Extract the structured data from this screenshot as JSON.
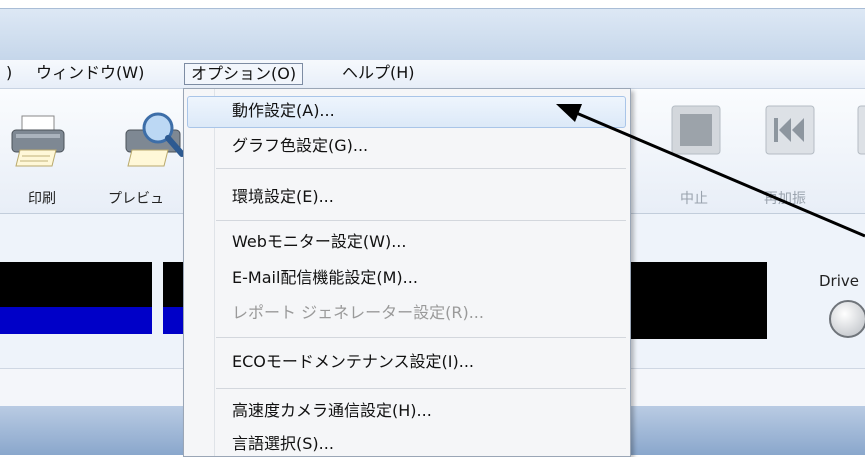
{
  "menubar": {
    "items": [
      {
        "label": ")"
      },
      {
        "label": "ウィンドウ(W)"
      },
      {
        "label": "オプション(O)"
      },
      {
        "label": "ヘルプ(H)"
      }
    ]
  },
  "toolbar": {
    "print_label": "印刷",
    "preview_label": "プレビュ",
    "stop_label": "中止",
    "reshake_label": "再加振"
  },
  "panel": {
    "drive_label": "Drive"
  },
  "options_menu": {
    "items": [
      {
        "label": "動作設定(A)..."
      },
      {
        "label": "グラフ色設定(G)..."
      },
      {
        "label": "環境設定(E)..."
      },
      {
        "label": "Webモニター設定(W)..."
      },
      {
        "label": "E-Mail配信機能設定(M)..."
      },
      {
        "label": "レポート ジェネレーター設定(R)..."
      },
      {
        "label": "ECOモードメンテナンス設定(I)..."
      },
      {
        "label": "高速度カメラ通信設定(H)..."
      },
      {
        "label": "言語選択(S)..."
      }
    ]
  },
  "colors": {
    "accent": "#0000c8",
    "menu_highlight": "#dce9f8",
    "disabled_text": "#9a9a9a"
  }
}
